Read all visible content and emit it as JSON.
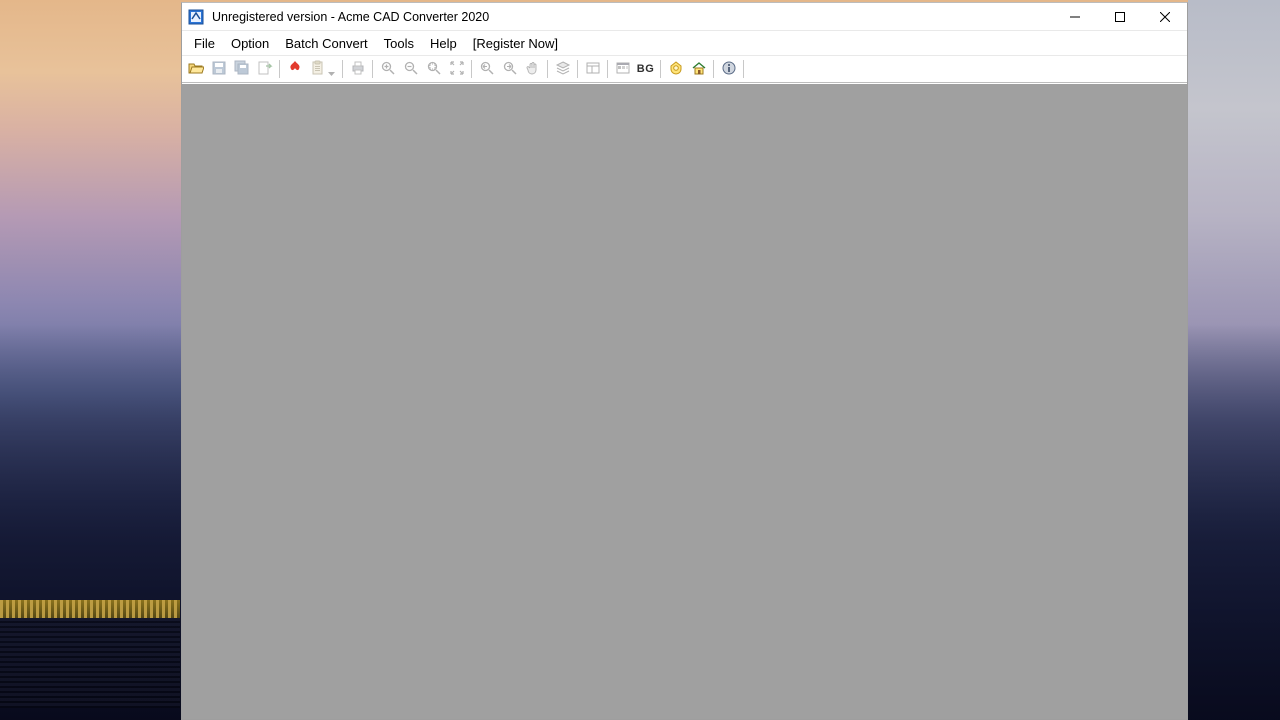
{
  "window": {
    "title": "Unregistered version - Acme CAD Converter 2020"
  },
  "menu": {
    "file": "File",
    "option": "Option",
    "batch_convert": "Batch Convert",
    "tools": "Tools",
    "help": "Help",
    "register_now": "[Register Now]"
  },
  "toolbar": {
    "open": "open-file-icon",
    "save": "save-icon",
    "save_all": "save-all-icon",
    "export": "export-dwg-icon",
    "convert_pdf": "pdf-icon",
    "copy_clipboard": "copy-icon",
    "print": "printer-icon",
    "zoom_in": "zoom-in-icon",
    "zoom_out": "zoom-out-icon",
    "zoom_window": "zoom-window-icon",
    "zoom_extents": "zoom-extents-icon",
    "zoom_prev": "zoom-prev-icon",
    "zoom_next": "zoom-next-icon",
    "pan": "pan-icon",
    "layers": "layers-icon",
    "layouts": "layouts-icon",
    "true_color": "true-color-icon",
    "bg_color": "bg-color-icon",
    "bg_label": "BG",
    "register": "register-icon",
    "home": "home-icon",
    "about": "about-icon"
  }
}
